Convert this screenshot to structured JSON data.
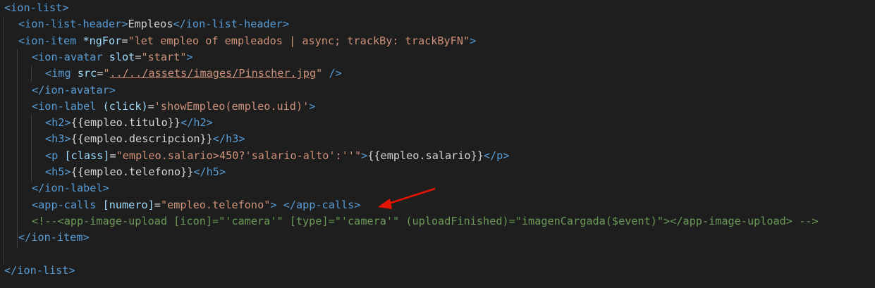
{
  "code_lines": [
    "<ion-list>",
    "<ion-list-header>Empleos</ion-list-header>",
    "<ion-item *ngFor=\"let empleo of empleados | async; trackBy: trackByFN\">",
    "<ion-avatar slot=\"start\">",
    "<img src=\"../../assets/images/Pinscher.jpg\" />",
    "</ion-avatar>",
    "<ion-label (click)='showEmpleo(empleo.uid)'>",
    "<h2>{{empleo.titulo}}</h2>",
    "<h3>{{empleo.descripcion}}</h3>",
    "<p [class]=\"empleo.salario>450?'salario-alto':''\">{{empleo.salario}}</p>",
    "<h5>{{empleo.telefono}}</h5>",
    "</ion-label>",
    "<app-calls [numero]=\"empleo.telefono\"> </app-calls>",
    "<!--<app-image-upload [icon]=\"'camera'\" [type]=\"'camera'\" (uploadFinished)=\"imagenCargada($event)\"></app-image-upload> -->",
    "</ion-item>",
    "",
    "</ion-list>"
  ],
  "tokens": {
    "l0": [
      "<",
      "ion-list",
      ">"
    ],
    "l1": [
      "<",
      "ion-list-header",
      ">",
      "Empleos",
      "</",
      "ion-list-header",
      ">"
    ],
    "l2": [
      "<",
      "ion-item",
      " ",
      "*ngFor",
      "=",
      "\"let empleo of empleados | async; trackBy: trackByFN\"",
      ">"
    ],
    "l3": [
      "<",
      "ion-avatar",
      " ",
      "slot",
      "=",
      "\"start\"",
      ">"
    ],
    "l4": [
      "<",
      "img",
      " ",
      "src",
      "=",
      "\"",
      "../../assets/images/Pinscher.jpg",
      "\"",
      " ",
      "/>"
    ],
    "l5": [
      "</",
      "ion-avatar",
      ">"
    ],
    "l6": [
      "<",
      "ion-label",
      " ",
      "(click)",
      "=",
      "'showEmpleo(empleo.uid)'",
      ">"
    ],
    "l7": [
      "<",
      "h2",
      ">",
      "{{empleo.titulo}}",
      "</",
      "h2",
      ">"
    ],
    "l8": [
      "<",
      "h3",
      ">",
      "{{empleo.descripcion}}",
      "</",
      "h3",
      ">"
    ],
    "l9": [
      "<",
      "p",
      " ",
      "[class]",
      "=",
      "\"empleo.salario>450?'salario-alto':''\"",
      ">",
      "{{empleo.salario}}",
      "</",
      "p",
      ">"
    ],
    "l10": [
      "<",
      "h5",
      ">",
      "{{empleo.telefono}}",
      "</",
      "h5",
      ">"
    ],
    "l11": [
      "</",
      "ion-label",
      ">"
    ],
    "l12": [
      "<",
      "app-calls",
      " ",
      "[numero]",
      "=",
      "\"empleo.telefono\"",
      ">",
      " ",
      "</",
      "app-calls",
      ">"
    ],
    "l13": [
      "<!--<app-image-upload [icon]=\"'camera'\" [type]=\"'camera'\" (uploadFinished)=\"imagenCargada($event)\"></app-image-upload> -->"
    ],
    "l14": [
      "</",
      "ion-item",
      ">"
    ],
    "l16": [
      "</",
      "ion-list",
      ">"
    ]
  },
  "colors": {
    "background": "#1e1e1e",
    "tag": "#569cd6",
    "attribute": "#9cdcfe",
    "string": "#ce9178",
    "text": "#d4d4d4",
    "comment": "#6a9955",
    "annotation_arrow": "#e51400"
  },
  "annotation": {
    "icon": "red-arrow-icon"
  }
}
